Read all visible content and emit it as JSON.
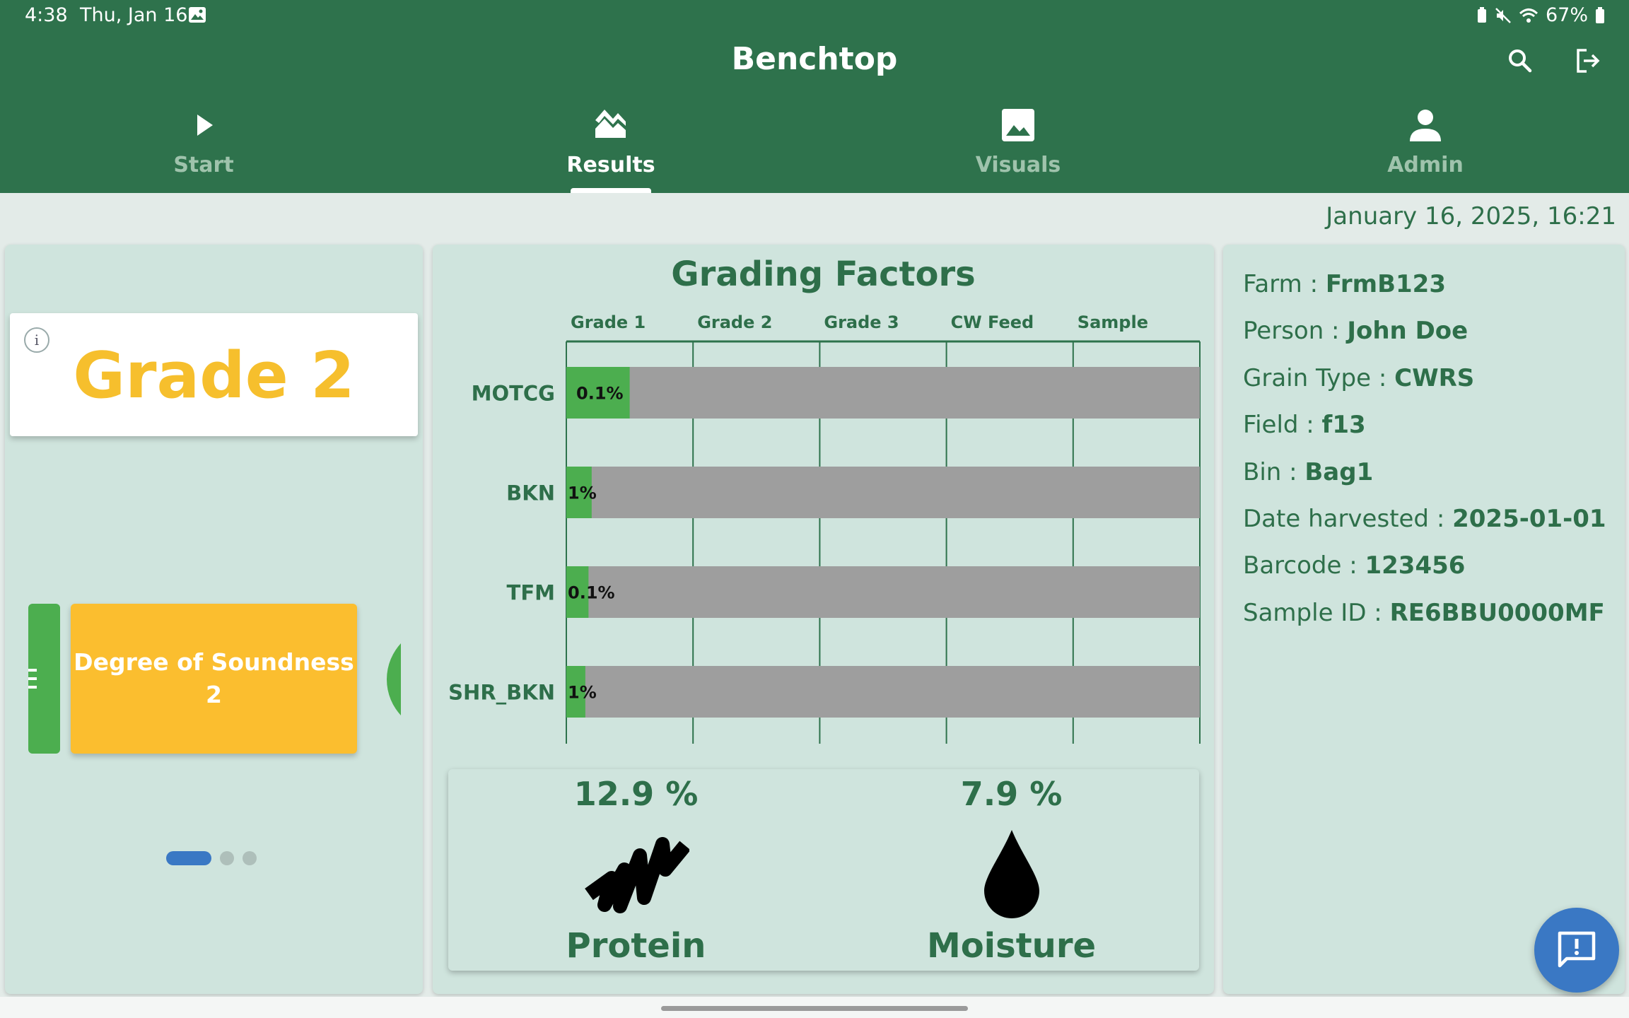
{
  "status_bar": {
    "time": "4:38",
    "date": "Thu, Jan 16",
    "battery": "67%"
  },
  "app": {
    "title": "Benchtop"
  },
  "tabs": [
    {
      "label": "Start",
      "icon": "play-icon",
      "active": false
    },
    {
      "label": "Results",
      "icon": "chart-icon",
      "active": true
    },
    {
      "label": "Visuals",
      "icon": "image-icon",
      "active": false
    },
    {
      "label": "Admin",
      "icon": "person-icon",
      "active": false
    }
  ],
  "timestamp": "January 16, 2025, 16:21",
  "grade": {
    "text": "Grade 2"
  },
  "carousel": {
    "current_title": "Degree of Soundness",
    "current_value": "2",
    "page_count": 3,
    "active_page": 1
  },
  "chart_data": {
    "type": "bar",
    "title": "Grading Factors",
    "columns": [
      "Grade 1",
      "Grade 2",
      "Grade 3",
      "CW Feed",
      "Sample"
    ],
    "categories": [
      "MOTCG",
      "BKN",
      "TFM",
      "SHR_BKN"
    ],
    "value_labels": [
      "0.1%",
      "1%",
      "0.1%",
      "1%"
    ],
    "fill_fractions": [
      0.1,
      0.04,
      0.035,
      0.03
    ],
    "colors": {
      "fill": "#4cae4f",
      "track": "#9e9e9e"
    }
  },
  "metrics": {
    "protein": {
      "value": "12.9 %",
      "label": "Protein"
    },
    "moisture": {
      "value": "7.9 %",
      "label": "Moisture"
    }
  },
  "details": [
    {
      "label": "Farm : ",
      "value": "FrmB123"
    },
    {
      "label": "Person : ",
      "value": "John Doe"
    },
    {
      "label": "Grain Type : ",
      "value": "CWRS"
    },
    {
      "label": "Field : ",
      "value": "f13"
    },
    {
      "label": "Bin : ",
      "value": "Bag1"
    },
    {
      "label": "Date harvested : ",
      "value": "2025-01-01"
    },
    {
      "label": "Barcode : ",
      "value": "123456"
    },
    {
      "label": "Sample ID : ",
      "value": "RE6BBU0000MF"
    }
  ],
  "colors": {
    "primary": "#2e724c",
    "panel": "#cfe4dd",
    "accent_yellow": "#f6bf2d",
    "fab": "#3a78c4"
  }
}
